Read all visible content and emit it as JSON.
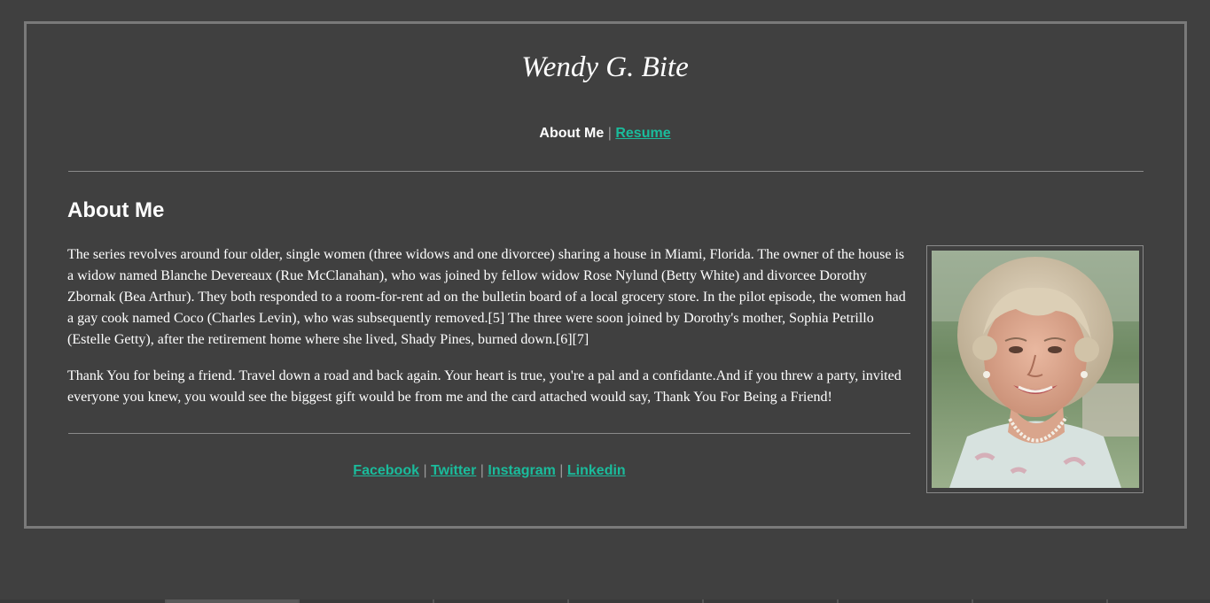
{
  "site": {
    "title": "Wendy G. Bite"
  },
  "nav": {
    "current": "About Me",
    "separator": "|",
    "resume": "Resume"
  },
  "section": {
    "heading": "About Me",
    "paragraphs": [
      "The series revolves around four older, single women (three widows and one divorcee) sharing a house in Miami, Florida. The owner of the house is a widow named Blanche Devereaux (Rue McClanahan), who was joined by fellow widow Rose Nylund (Betty White) and divorcee Dorothy Zbornak (Bea Arthur). They both responded to a room-for-rent ad on the bulletin board of a local grocery store. In the pilot episode, the women had a gay cook named Coco (Charles Levin), who was subsequently removed.[5] The three were soon joined by Dorothy's mother, Sophia Petrillo (Estelle Getty), after the retirement home where she lived, Shady Pines, burned down.[6][7]",
      "Thank You for being a friend. Travel down a road and back again. Your heart is true, you're a pal and a confidante.And if you threw a party, invited everyone you knew, you would see the biggest gift would be from me and the card attached would say, Thank You For Being a Friend!"
    ]
  },
  "social": {
    "facebook": "Facebook",
    "twitter": "Twitter",
    "instagram": "Instagram",
    "linkedin": "Linkedin",
    "separator": "|"
  },
  "colors": {
    "background": "#404040",
    "link": "#1abc9c",
    "text": "#ffffff",
    "border": "#7a7a7a"
  }
}
